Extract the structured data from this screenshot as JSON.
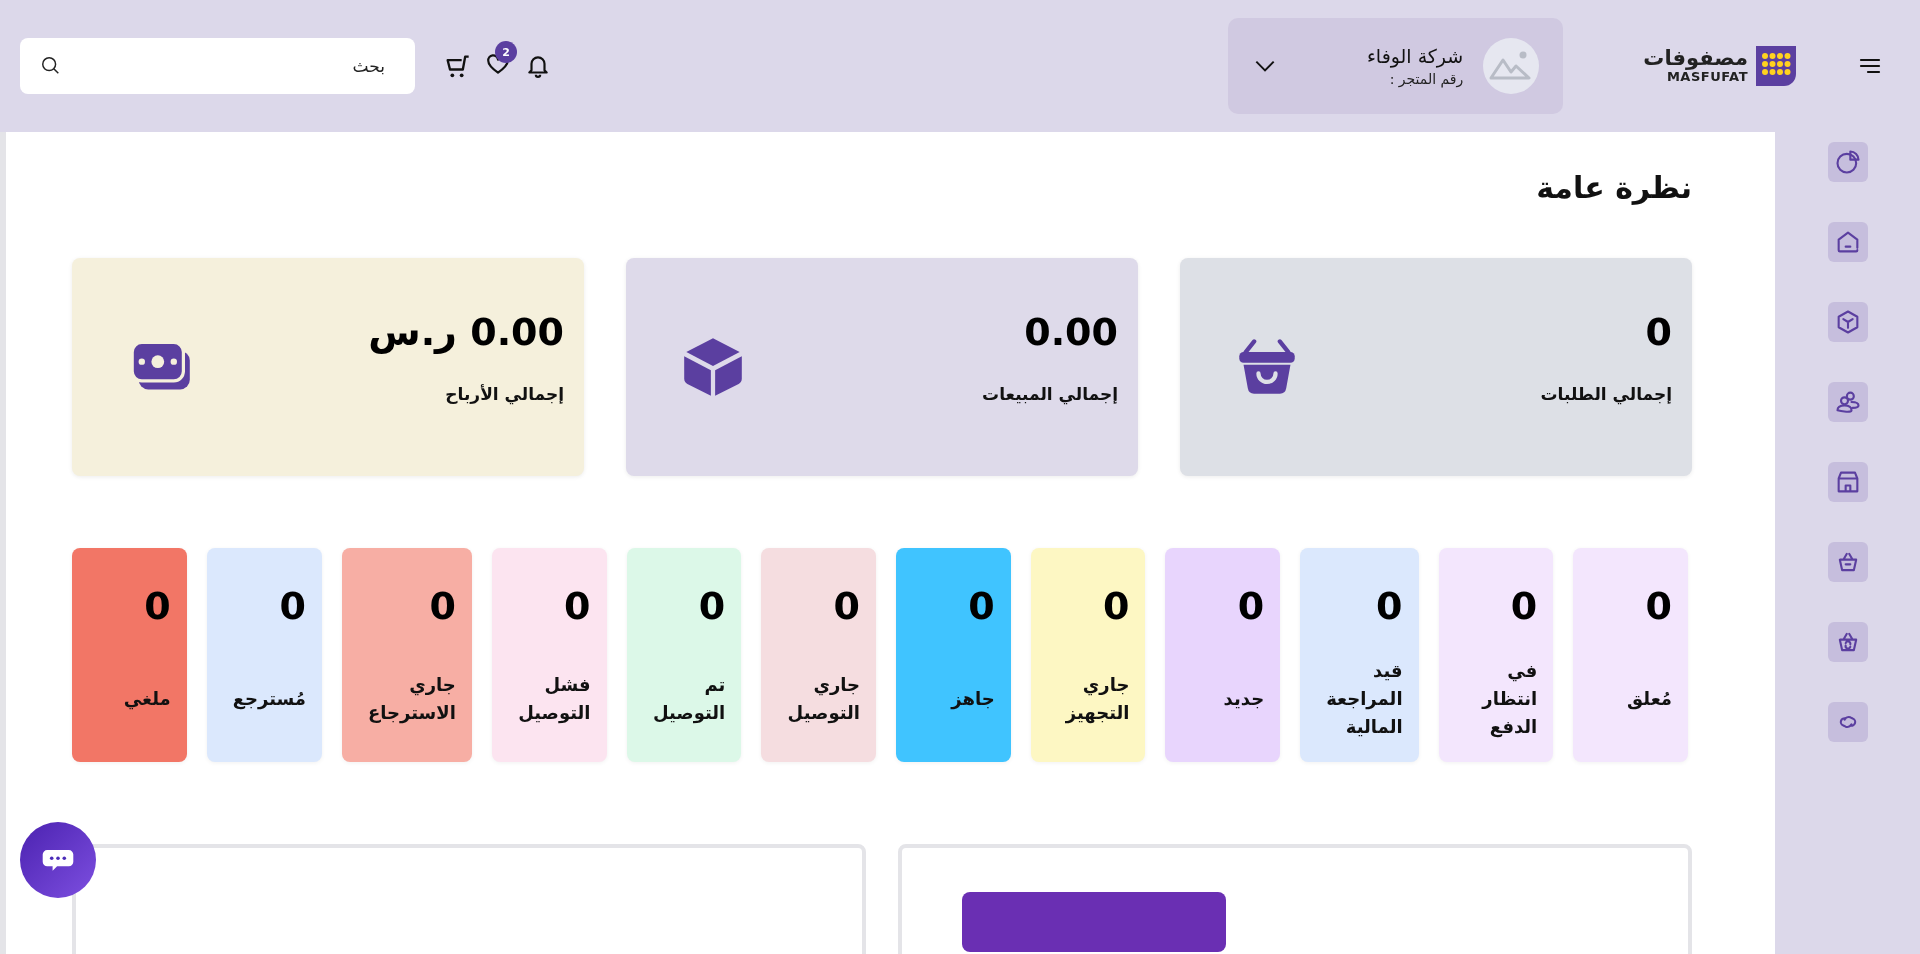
{
  "header": {
    "logo": {
      "arabic": "مصفوفات",
      "latin": "MASFUFAT"
    },
    "store": {
      "name": "شركة الوفاء",
      "number_label": "رقم المتجر :"
    },
    "wishlist_badge": "2",
    "search": {
      "placeholder": "بحث"
    }
  },
  "page_title": "نظرة عامة",
  "summary_cards": [
    {
      "kind": "orders",
      "value": "0",
      "label": "إجمالي الطلبات",
      "color": "#dde0e6"
    },
    {
      "kind": "sales",
      "value": "0.00",
      "label": "إجمالي المبيعات",
      "color": "#dedaea"
    },
    {
      "kind": "profits",
      "value": "0.00 ر.س",
      "label": "إجمالي الأرباح",
      "color": "#f5f0dc"
    }
  ],
  "status_cards": [
    {
      "value": "0",
      "label": "مُعلق",
      "color": "#f3e6fd"
    },
    {
      "value": "0",
      "label": "في انتظار الدفع",
      "color": "#f3e6fd"
    },
    {
      "value": "0",
      "label": "قيد المراجعة المالية",
      "color": "#dbe8fd"
    },
    {
      "value": "0",
      "label": "جديد",
      "color": "#e8d5fd"
    },
    {
      "value": "0",
      "label": "جاري التجهيز",
      "color": "#fdf7c3"
    },
    {
      "value": "0",
      "label": "جاهز",
      "color": "#40c4ff"
    },
    {
      "value": "0",
      "label": "جاري التوصيل",
      "color": "#f5dde0"
    },
    {
      "value": "0",
      "label": "تم التوصيل",
      "color": "#dcf8e8"
    },
    {
      "value": "0",
      "label": "فشل التوصيل",
      "color": "#fce4f0"
    },
    {
      "value": "0",
      "label": "جاري الاسترجاع",
      "color": "#f7aea4"
    },
    {
      "value": "0",
      "label": "مُسترجع",
      "color": "#dbe8fd"
    },
    {
      "value": "0",
      "label": "ملغي",
      "color": "#f27666"
    }
  ]
}
